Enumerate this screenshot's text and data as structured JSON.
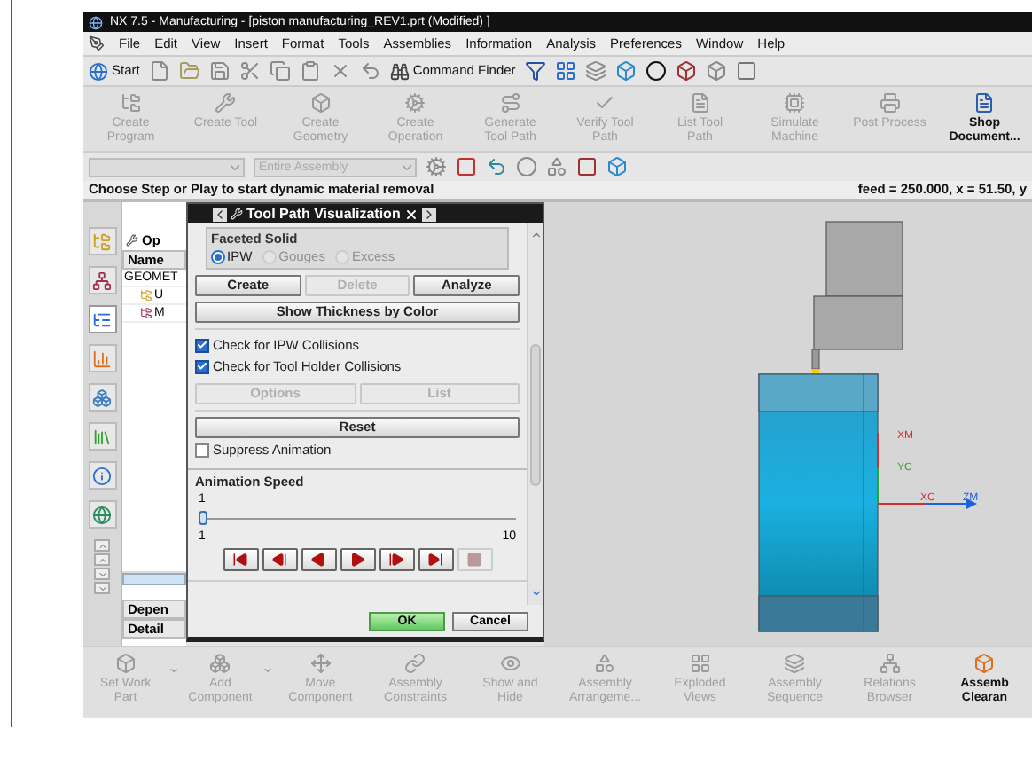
{
  "window": {
    "title": "NX 7.5 - Manufacturing - [piston manufacturing_REV1.prt (Modified) ]"
  },
  "menu": [
    "File",
    "Edit",
    "View",
    "Insert",
    "Format",
    "Tools",
    "Assemblies",
    "Information",
    "Analysis",
    "Preferences",
    "Window",
    "Help"
  ],
  "standard_toolbar": {
    "start": "Start",
    "command_finder": "Command Finder"
  },
  "operations_toolbar": [
    {
      "label": [
        "Create",
        "Program"
      ],
      "disabled": true
    },
    {
      "label": [
        "Create Tool"
      ],
      "disabled": true
    },
    {
      "label": [
        "Create",
        "Geometry"
      ],
      "disabled": true
    },
    {
      "label": [
        "Create",
        "Operation"
      ],
      "disabled": true
    },
    {
      "label": [
        "Generate",
        "Tool Path"
      ],
      "disabled": true
    },
    {
      "label": [
        "Verify Tool",
        "Path"
      ],
      "disabled": true
    },
    {
      "label": [
        "List Tool",
        "Path"
      ],
      "disabled": true
    },
    {
      "label": [
        "Simulate",
        "Machine"
      ],
      "disabled": true
    },
    {
      "label": [
        "Post Process"
      ],
      "disabled": true
    },
    {
      "label": [
        "Shop",
        "Document..."
      ],
      "disabled": false
    }
  ],
  "selection_bar": {
    "scope": "Entire Assembly"
  },
  "resource_tabs": [
    {
      "selected": false
    },
    {
      "selected": false
    },
    {
      "selected": true
    },
    {
      "selected": false
    },
    {
      "selected": false
    },
    {
      "selected": false
    },
    {
      "selected": false
    },
    {
      "selected": false
    }
  ],
  "status": {
    "prompt": "Choose Step or Play to start dynamic material removal",
    "readout": "feed = 250.000, x = 51.50, y"
  },
  "navigator": {
    "title": "Op",
    "column": "Name",
    "rows": [
      "GEOMET",
      "U",
      "M"
    ],
    "panels": [
      "Depen",
      "Detail"
    ]
  },
  "dialog": {
    "title": "Tool Path Visualization",
    "group": "Faceted Solid",
    "radios": [
      {
        "label": "IPW",
        "selected": true,
        "disabled": false
      },
      {
        "label": "Gouges",
        "selected": false,
        "disabled": true
      },
      {
        "label": "Excess",
        "selected": false,
        "disabled": true
      }
    ],
    "actions": [
      {
        "label": "Create",
        "disabled": false
      },
      {
        "label": "Delete",
        "disabled": true
      },
      {
        "label": "Analyze",
        "disabled": false
      }
    ],
    "thickness_button": "Show Thickness by Color",
    "checks": [
      {
        "label": "Check for IPW Collisions",
        "checked": true
      },
      {
        "label": "Check for Tool Holder Collisions",
        "checked": true
      }
    ],
    "collision_actions": [
      {
        "label": "Options",
        "disabled": true
      },
      {
        "label": "List",
        "disabled": true
      }
    ],
    "reset": "Reset",
    "suppress": {
      "label": "Suppress Animation",
      "checked": false
    },
    "speed": {
      "label": "Animation Speed",
      "value": "1",
      "min": "1",
      "max": "10",
      "level": 0
    },
    "playback": [
      {
        "kind": "start",
        "disabled": false
      },
      {
        "kind": "step_back",
        "disabled": false
      },
      {
        "kind": "play_back",
        "disabled": false
      },
      {
        "kind": "play",
        "disabled": false
      },
      {
        "kind": "step",
        "disabled": false
      },
      {
        "kind": "end",
        "disabled": false
      },
      {
        "kind": "stop",
        "disabled": true
      }
    ],
    "ok": "OK",
    "cancel": "Cancel"
  },
  "graphics": {
    "axis_labels": [
      "XM",
      "YC",
      "XC",
      "ZM"
    ]
  },
  "assembly_toolbar": [
    {
      "label": [
        "Set Work",
        "Part"
      ],
      "disabled": true,
      "dropdown": true
    },
    {
      "label": [
        "Add",
        "Component"
      ],
      "disabled": true,
      "dropdown": true
    },
    {
      "label": [
        "Move",
        "Component"
      ],
      "disabled": true,
      "dropdown": false
    },
    {
      "label": [
        "Assembly",
        "Constraints"
      ],
      "disabled": true,
      "dropdown": false
    },
    {
      "label": [
        "Show and",
        "Hide"
      ],
      "disabled": true,
      "dropdown": false
    },
    {
      "label": [
        "Assembly",
        "Arrangeme..."
      ],
      "disabled": true,
      "dropdown": false
    },
    {
      "label": [
        "Exploded",
        "Views"
      ],
      "disabled": true,
      "dropdown": false
    },
    {
      "label": [
        "Assembly",
        "Sequence"
      ],
      "disabled": true,
      "dropdown": false
    },
    {
      "label": [
        "Relations",
        "Browser"
      ],
      "disabled": true,
      "dropdown": false
    },
    {
      "label": [
        "Assemb",
        "Clearan"
      ],
      "disabled": false,
      "dropdown": false
    }
  ]
}
